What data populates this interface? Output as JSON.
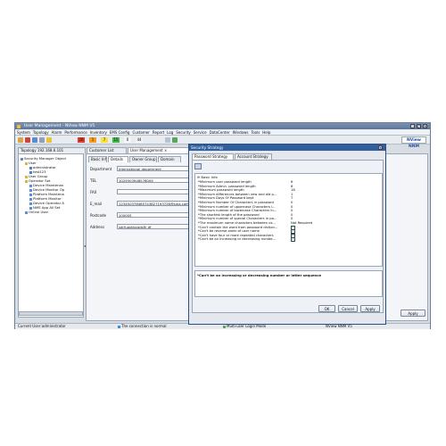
{
  "window": {
    "title": "User Management - NView NNM V5",
    "controls": [
      "_",
      "□",
      "×"
    ]
  },
  "menu": [
    "System",
    "Topology",
    "Alarm",
    "Performance",
    "Inventory",
    "EMS Config",
    "Customer",
    "Report",
    "Log",
    "Security",
    "Service",
    "DataCenter",
    "Windows",
    "Tools",
    "Help"
  ],
  "toolbar": {
    "alarm_counts": [
      {
        "value": "26",
        "color": "#e53c2e"
      },
      {
        "value": "1",
        "color": "#f39a21"
      },
      {
        "value": "7",
        "color": "#f7e23a"
      },
      {
        "value": "15",
        "color": "#43b649"
      },
      {
        "value": "0",
        "color": "#f2f4f6"
      },
      {
        "value": "44",
        "color": "#f2f4f6"
      }
    ],
    "brand": "NView NNM"
  },
  "tabs": [
    {
      "label": "Topology 192.168.6.101"
    },
    {
      "label": "Customer List"
    },
    {
      "label": "User Management"
    }
  ],
  "tree": {
    "items": [
      {
        "label": "Security Manager Object",
        "indent": 0,
        "color": "#6f86b8"
      },
      {
        "label": "User",
        "indent": 1,
        "color": "#e0b43a"
      },
      {
        "label": "administrator",
        "indent": 2,
        "color": "#4c7bd0"
      },
      {
        "label": "test123",
        "indent": 2,
        "color": "#4c7bd0"
      },
      {
        "label": "User Group",
        "indent": 1,
        "color": "#e0b43a"
      },
      {
        "label": "Operator Set",
        "indent": 1,
        "color": "#e0b43a"
      },
      {
        "label": "Device Maintenan",
        "indent": 2,
        "color": "#5a8fd8"
      },
      {
        "label": "Device Monitor Op",
        "indent": 2,
        "color": "#5a8fd8"
      },
      {
        "label": "Platform Maintena",
        "indent": 2,
        "color": "#5a8fd8"
      },
      {
        "label": "Platform Monitor",
        "indent": 2,
        "color": "#5a8fd8"
      },
      {
        "label": "Device Operator A",
        "indent": 2,
        "color": "#5a8fd8"
      },
      {
        "label": "NMS App All Set",
        "indent": 2,
        "color": "#5a8fd8"
      },
      {
        "label": "Online User",
        "indent": 1,
        "color": "#5a8fd8"
      }
    ]
  },
  "detail_tabs": [
    "Basic Info",
    "Details",
    "Owner Group",
    "Domain"
  ],
  "details": [
    {
      "label": "Department",
      "value": "International department"
    },
    {
      "label": "TEL",
      "value": "1029303948576009"
    },
    {
      "label": "FAX",
      "value": ""
    },
    {
      "label": "E_mail",
      "value": "123450378465743827193726@sina.com"
    },
    {
      "label": "Postcode",
      "value": "100005"
    },
    {
      "label": "Address",
      "value": "sdrfuashbcadsfh df"
    }
  ],
  "right_button": "Apply",
  "status": {
    "user": "Current User:administrator",
    "connection": "The connection is normal",
    "mode": "Multi-user Login Mode",
    "version": "NView NNM V5"
  },
  "dialog": {
    "title": "Security Strategy",
    "tabs": [
      "Password Strategy",
      "Account Strategy"
    ],
    "section": "Basic Info",
    "rows": [
      {
        "k": "*Minimum user password length",
        "v": "6",
        "check": false
      },
      {
        "k": "*Minimum Admin. password length",
        "v": "8",
        "check": false
      },
      {
        "k": "*Maximum password length",
        "v": "18",
        "check": false
      },
      {
        "k": "*Minimum differences between new and old p...",
        "v": "1",
        "check": false
      },
      {
        "k": "*Minimum Days Of Password kept",
        "v": "7",
        "check": false
      },
      {
        "k": "*Minimum Number Of Characters in password",
        "v": "0",
        "check": false
      },
      {
        "k": "*Minimum number of uppercase Characters i...",
        "v": "0",
        "check": false
      },
      {
        "k": "*Minimum number of lowercase Characters in...",
        "v": "0",
        "check": false
      },
      {
        "k": "*The shortest length of the password",
        "v": "0",
        "check": false
      },
      {
        "k": "*Minimum number of special Characters in pa...",
        "v": "0",
        "check": false
      },
      {
        "k": "*The maximum name characters between us...",
        "v": "Not Required",
        "check": false
      },
      {
        "k": "*Can't contain the word from password diction...",
        "v": "",
        "check": true
      },
      {
        "k": "*Can't be reverse order of user name",
        "v": "",
        "check": true
      },
      {
        "k": "*Can't have four or more repeated characters",
        "v": "",
        "check": true
      },
      {
        "k": "*Can't be an increasing or decreasing numbe...",
        "v": "",
        "check": true
      }
    ],
    "description": "*Can't be an increasing or decreasing number or letter sequence",
    "buttons": {
      "ok": "OK",
      "cancel": "Cancel",
      "apply": "Apply"
    }
  }
}
